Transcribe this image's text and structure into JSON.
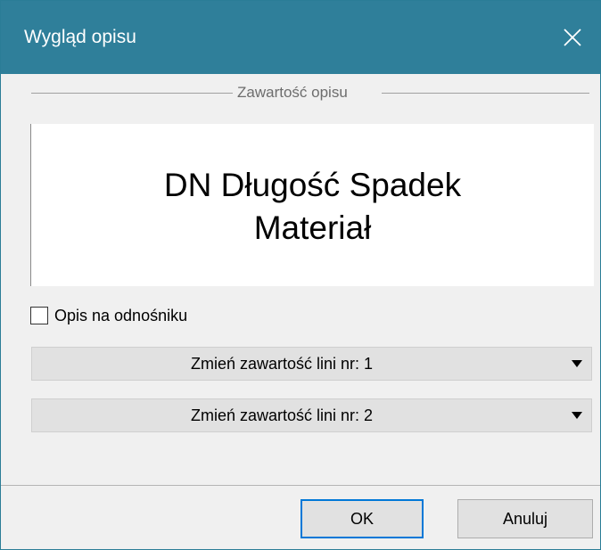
{
  "window": {
    "title": "Wygląd opisu",
    "close_icon": "close-icon"
  },
  "group": {
    "label": "Zawartość opisu"
  },
  "preview": {
    "lines": [
      "DN Długość Spadek",
      "Materiał"
    ]
  },
  "checkbox": {
    "label": "Opis na odnośniku",
    "checked": false
  },
  "dropdowns": [
    {
      "label": "Zmień zawartość lini nr: 1",
      "icon": "chevron-down-icon"
    },
    {
      "label": "Zmień zawartość lini nr: 2",
      "icon": "chevron-down-icon"
    }
  ],
  "buttons": {
    "ok_label": "OK",
    "cancel_label": "Anuluj"
  },
  "colors": {
    "titlebar": "#2f7f9a",
    "focus_border": "#0078d7"
  }
}
